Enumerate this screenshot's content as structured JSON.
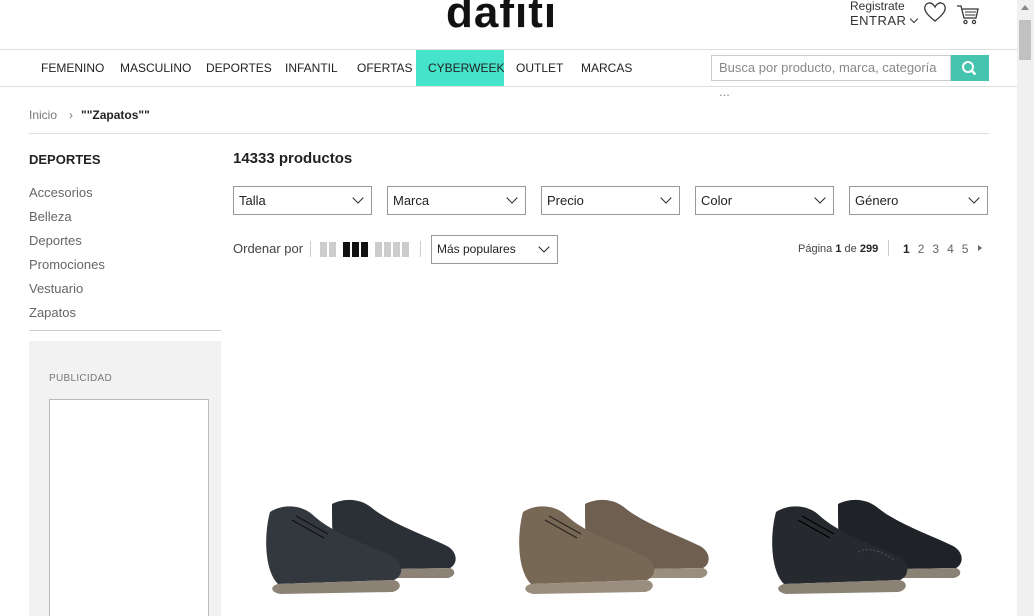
{
  "header": {
    "logo": "dafiti",
    "register_label": "Registrate",
    "enter_label": "ENTRAR"
  },
  "nav": {
    "items": [
      {
        "label": "FEMENINO"
      },
      {
        "label": "MASCULINO"
      },
      {
        "label": "DEPORTES"
      },
      {
        "label": "INFANTIL"
      },
      {
        "label": "OFERTAS"
      },
      {
        "label": "CYBERWEEK"
      },
      {
        "label": "OUTLET"
      },
      {
        "label": "MARCAS"
      }
    ],
    "active_item": "CYBERWEEK",
    "search_placeholder": "Busca por producto, marca, categoría ..."
  },
  "breadcrumb": {
    "home": "Inicio",
    "current": "\"\"Zapatos\"\""
  },
  "sidebar": {
    "title": "DEPORTES",
    "items": [
      "Accesorios",
      "Belleza",
      "Deportes",
      "Promociones",
      "Vestuario",
      "Zapatos"
    ],
    "ad_label": "PUBLICIDAD"
  },
  "main": {
    "count": "14333 productos",
    "filters": [
      "Talla",
      "Marca",
      "Precio",
      "Color",
      "Género"
    ],
    "order_label": "Ordenar por",
    "sort_value": "Más populares",
    "pagination": {
      "prefix": "Página",
      "current": "1",
      "of": "de",
      "total": "299",
      "pages": [
        "1",
        "2",
        "3",
        "4",
        "5"
      ]
    },
    "products": [
      {
        "color": "#2b3036",
        "sole": "#8c8376"
      },
      {
        "color": "#6e5f50",
        "sole": "#9a8e7e"
      },
      {
        "color": "#1f2226",
        "sole": "#8a8275"
      }
    ]
  },
  "colors": {
    "accent": "#45e3c9",
    "search_button": "#45c4b0"
  }
}
